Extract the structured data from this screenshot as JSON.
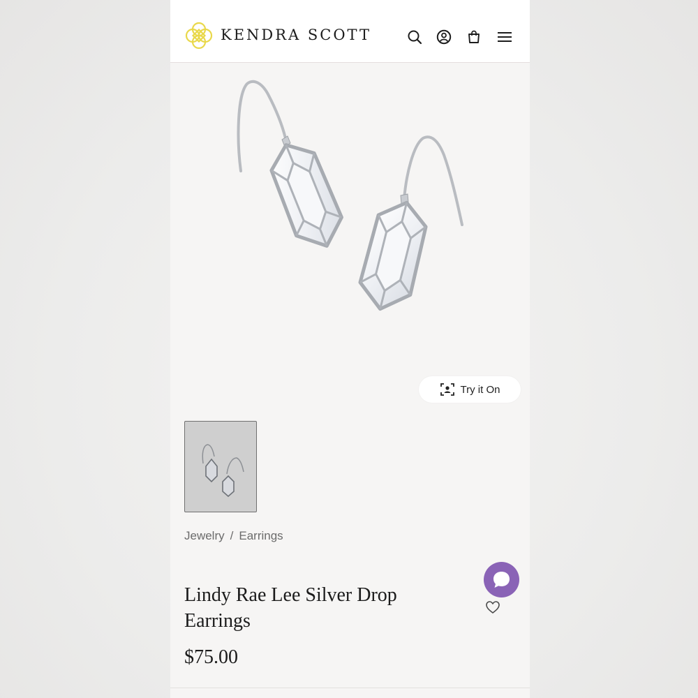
{
  "header": {
    "brand": "KENDRA SCOTT",
    "icons": [
      "search-icon",
      "account-icon",
      "bag-icon",
      "menu-icon"
    ],
    "logo_color": "#e9d84a"
  },
  "product_image": {
    "try_on_label": "Try it On"
  },
  "breadcrumb": {
    "items": [
      "Jewelry",
      "Earrings"
    ],
    "separator": "/"
  },
  "product": {
    "title": "Lindy Rae Lee Silver Drop Earrings",
    "price": "$75.00"
  },
  "colors": {
    "chat_bubble": "#8a63b6",
    "thumbnail_bg": "#cfcfcf"
  }
}
